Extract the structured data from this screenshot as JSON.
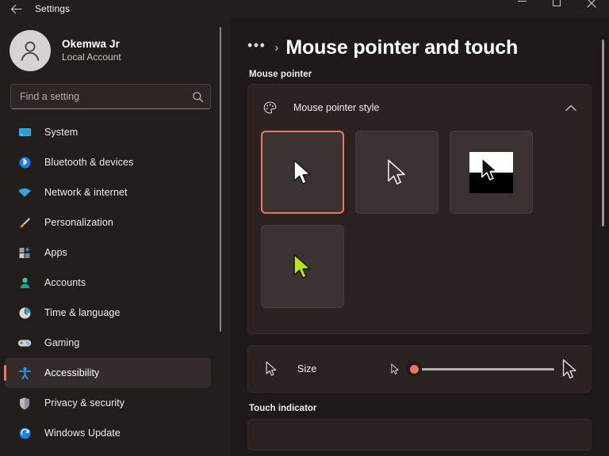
{
  "window": {
    "title": "Settings",
    "back_icon": "back-arrow-icon",
    "minimize_label": "Minimize",
    "maximize_label": "Maximize",
    "close_label": "Close"
  },
  "sidebar": {
    "account": {
      "name": "Okemwa Jr",
      "subtitle": "Local Account",
      "avatar_icon": "person-avatar-icon"
    },
    "search": {
      "placeholder": "Find a setting",
      "value": "",
      "icon": "search-icon"
    },
    "items": [
      {
        "label": "System",
        "icon": "monitor-icon",
        "active": false
      },
      {
        "label": "Bluetooth & devices",
        "icon": "bluetooth-icon",
        "active": false
      },
      {
        "label": "Network & internet",
        "icon": "wifi-icon",
        "active": false
      },
      {
        "label": "Personalization",
        "icon": "paintbrush-icon",
        "active": false
      },
      {
        "label": "Apps",
        "icon": "apps-grid-icon",
        "active": false
      },
      {
        "label": "Accounts",
        "icon": "account-person-icon",
        "active": false
      },
      {
        "label": "Time & language",
        "icon": "clock-icon",
        "active": false
      },
      {
        "label": "Gaming",
        "icon": "gamepad-icon",
        "active": false
      },
      {
        "label": "Accessibility",
        "icon": "accessibility-person-icon",
        "active": true
      },
      {
        "label": "Privacy & security",
        "icon": "shield-icon",
        "active": false
      },
      {
        "label": "Windows Update",
        "icon": "update-refresh-icon",
        "active": false
      }
    ]
  },
  "main": {
    "breadcrumb": {
      "overflow": "•••",
      "separator": "›",
      "title": "Mouse pointer and touch"
    },
    "mouse_pointer": {
      "section_label": "Mouse pointer",
      "card": {
        "title": "Mouse pointer style",
        "icon": "palette-icon",
        "expand_icon": "chevron-up-icon",
        "expanded": true
      },
      "styles": [
        {
          "name": "White",
          "selected": true,
          "kind": "white"
        },
        {
          "name": "Black",
          "selected": false,
          "kind": "black"
        },
        {
          "name": "Inverted",
          "selected": false,
          "kind": "inverted"
        },
        {
          "name": "Custom",
          "selected": false,
          "kind": "custom",
          "color": "#b5e61d"
        }
      ],
      "size": {
        "label": "Size",
        "value": 1,
        "min": 1,
        "max": 15,
        "left_icon": "cursor-small-icon",
        "slider_min_icon": "cursor-tiny-icon",
        "slider_max_icon": "cursor-large-icon"
      }
    },
    "touch_indicator": {
      "section_label": "Touch indicator"
    }
  },
  "colors": {
    "accent": "#e8795e",
    "window_bg": "#1f1a19",
    "sidebar_bg": "#231d1c",
    "card_bg": "#2a2322",
    "swatch_bg": "#3b3332"
  }
}
